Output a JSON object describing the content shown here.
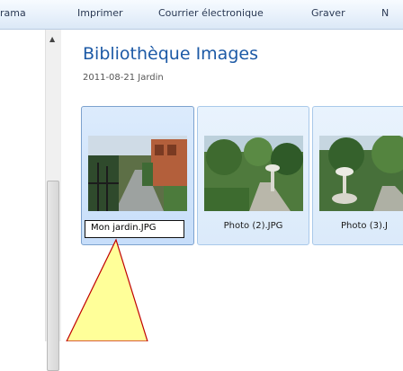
{
  "toolbar": {
    "items": [
      "rama",
      "Imprimer",
      "Courrier électronique",
      "Graver",
      "N"
    ]
  },
  "library": {
    "title": "Bibliothèque Images",
    "subtitle": "2011-08-21 Jardin"
  },
  "photos": [
    {
      "caption": "Mon jardin.JPG",
      "renaming": true
    },
    {
      "caption": "Photo (2).JPG",
      "renaming": false
    },
    {
      "caption": "Photo (3).J",
      "renaming": false
    }
  ],
  "icons": {
    "scroll_up": "triangle-up"
  },
  "colors": {
    "title": "#1d5aa6",
    "callout_fill": "#ffff99",
    "callout_stroke": "#c00000"
  }
}
